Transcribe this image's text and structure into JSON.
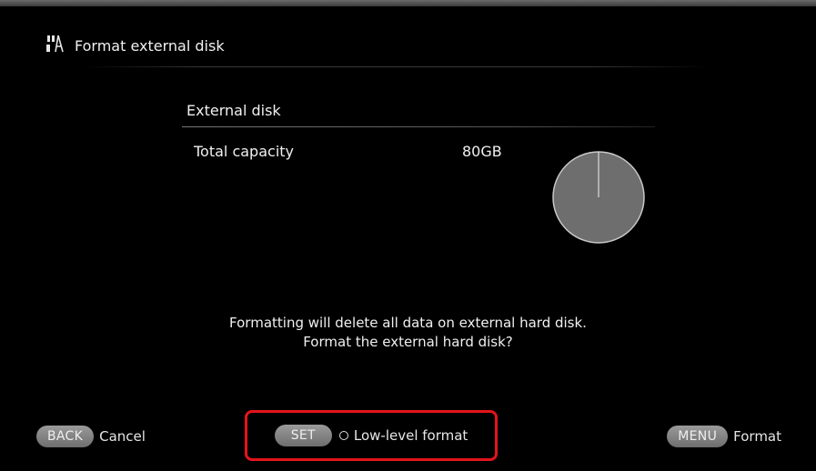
{
  "header": {
    "icon": "disk-format-icon",
    "title": "Format external disk"
  },
  "disk": {
    "section_title": "External disk",
    "capacity_label": "Total capacity",
    "capacity_value": "80GB",
    "used_fraction": 0.0
  },
  "message": {
    "line1": "Formatting will delete all data on external hard disk.",
    "line2": "Format the external hard disk?"
  },
  "footer": {
    "back_key": "BACK",
    "back_label": "Cancel",
    "set_key": "SET",
    "set_label": "Low-level format",
    "set_checked": false,
    "menu_key": "MENU",
    "menu_label": "Format"
  },
  "colors": {
    "background": "#000000",
    "highlight": "#e3141b",
    "pie_fill": "#6e6e6e"
  }
}
